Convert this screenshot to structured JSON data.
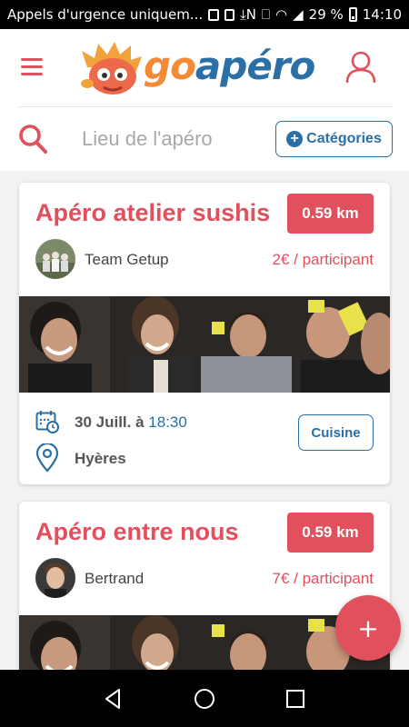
{
  "statusbar": {
    "notification_text": "Appels d'urgence uniquem...",
    "nfc_label": "N",
    "battery": "29 %",
    "time": "14:10"
  },
  "header": {
    "logo_go": "go",
    "logo_apero": "apéro"
  },
  "search": {
    "placeholder": "Lieu de l'apéro",
    "categories_label": "Catégories"
  },
  "events": [
    {
      "title": "Apéro atelier sushis",
      "distance": "0.59 km",
      "host": "Team Getup",
      "price": "2€ / participant",
      "date": "30 Juill. à ",
      "time": "18:30",
      "city": "Hyères",
      "tag": "Cuisine"
    },
    {
      "title": "Apéro entre nous",
      "distance": "0.59 km",
      "host": "Bertrand",
      "price": "7€ / participant"
    }
  ],
  "fab_label": "+",
  "colors": {
    "accent_red": "#e0505d",
    "accent_blue": "#2a6fa5",
    "logo_orange": "#f28a36"
  }
}
